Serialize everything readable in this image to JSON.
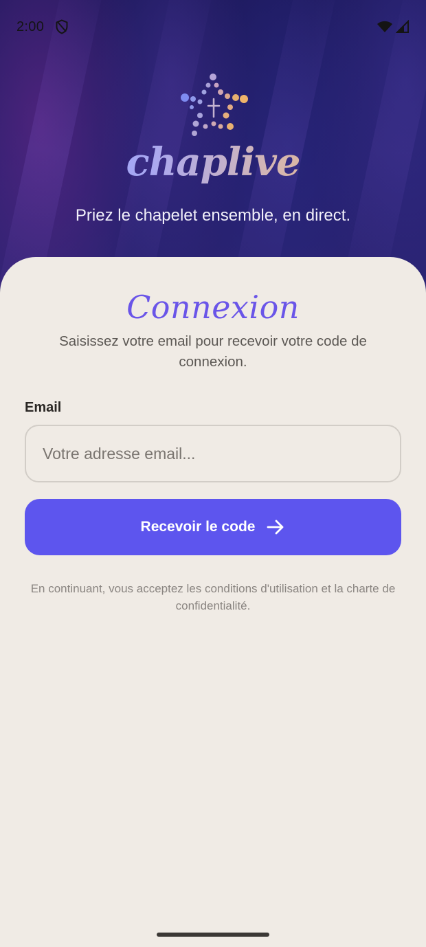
{
  "status_bar": {
    "time": "2:00",
    "icons": [
      "shield-icon",
      "wifi-icon",
      "signal-icon"
    ]
  },
  "hero": {
    "app_name": "chaplive",
    "tagline": "Priez le chapelet ensemble, en direct."
  },
  "login": {
    "title": "Connexion",
    "subtitle": "Saisissez votre email pour recevoir votre code de connexion.",
    "email_label": "Email",
    "email_value": "",
    "email_placeholder": "Votre adresse email...",
    "submit_label": "Recevoir le code",
    "submit_icon": "arrow-right-icon",
    "legal_text": "En continuant, vous acceptez les conditions d'utilisation et la charte de confidentialité."
  },
  "colors": {
    "accent": "#5d55ee",
    "title": "#6a55e8",
    "sheet_background": "#f0ebe5",
    "hero_background": "#1d1b5c"
  }
}
